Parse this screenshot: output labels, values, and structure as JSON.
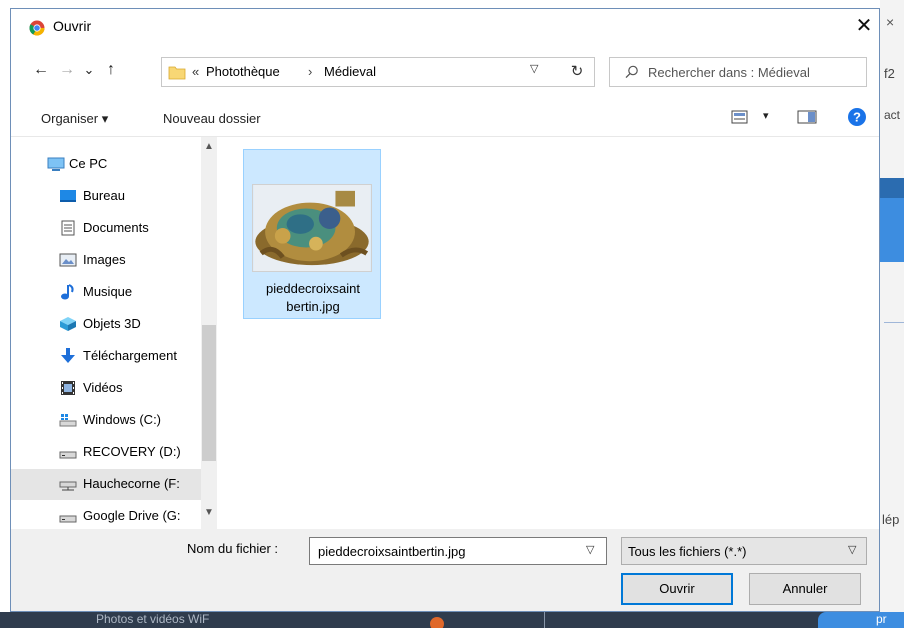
{
  "dialog": {
    "title": "Ouvrir",
    "close_glyph": "✕"
  },
  "background": {
    "close_glyph": "×",
    "text1": "f2",
    "text2": "act",
    "text3": "lép",
    "bottom_text": "Photos et vidéos WiF",
    "bottom_btn": "pr"
  },
  "nav": {
    "back": "←",
    "forward": "→",
    "recent": "⌄",
    "up": "↑",
    "breadcrumb_prefix": "«",
    "breadcrumb": [
      "Photothèque",
      "Médieval"
    ],
    "separator": "›",
    "refresh": "↻",
    "search_placeholder": "Rechercher dans : Médieval"
  },
  "toolbar": {
    "organiser": "Organiser ▾",
    "new_folder": "Nouveau dossier"
  },
  "sidebar": {
    "items": [
      {
        "label": "Ce PC",
        "icon": "pc-icon",
        "selected": false
      },
      {
        "label": "Bureau",
        "icon": "desktop-icon",
        "selected": false
      },
      {
        "label": "Documents",
        "icon": "documents-icon",
        "selected": false
      },
      {
        "label": "Images",
        "icon": "images-icon",
        "selected": false
      },
      {
        "label": "Musique",
        "icon": "music-icon",
        "selected": false
      },
      {
        "label": "Objets 3D",
        "icon": "objects-3d-icon",
        "selected": false
      },
      {
        "label": "Téléchargement",
        "icon": "download-icon",
        "selected": false
      },
      {
        "label": "Vidéos",
        "icon": "video-icon",
        "selected": false
      },
      {
        "label": "Windows (C:)",
        "icon": "windows-drive-icon",
        "selected": false
      },
      {
        "label": "RECOVERY (D:)",
        "icon": "drive-icon",
        "selected": false
      },
      {
        "label": "Hauchecorne (F:",
        "icon": "network-drive-icon",
        "selected": true
      },
      {
        "label": "Google Drive (G:",
        "icon": "drive-icon",
        "selected": false
      }
    ]
  },
  "files": [
    {
      "name_line1": "pieddecroixsaint",
      "name_line2": "bertin.jpg"
    }
  ],
  "footer": {
    "filename_label": "Nom du fichier :",
    "filename_value": "pieddecroixsaintbertin.jpg",
    "filter_value": "Tous les fichiers (*.*)",
    "open_button": "Ouvrir",
    "cancel_button": "Annuler"
  },
  "colors": {
    "selection_bg": "#cce8ff",
    "selection_border": "#99d1ff",
    "accent": "#0078d7",
    "help": "#1a73e8"
  }
}
